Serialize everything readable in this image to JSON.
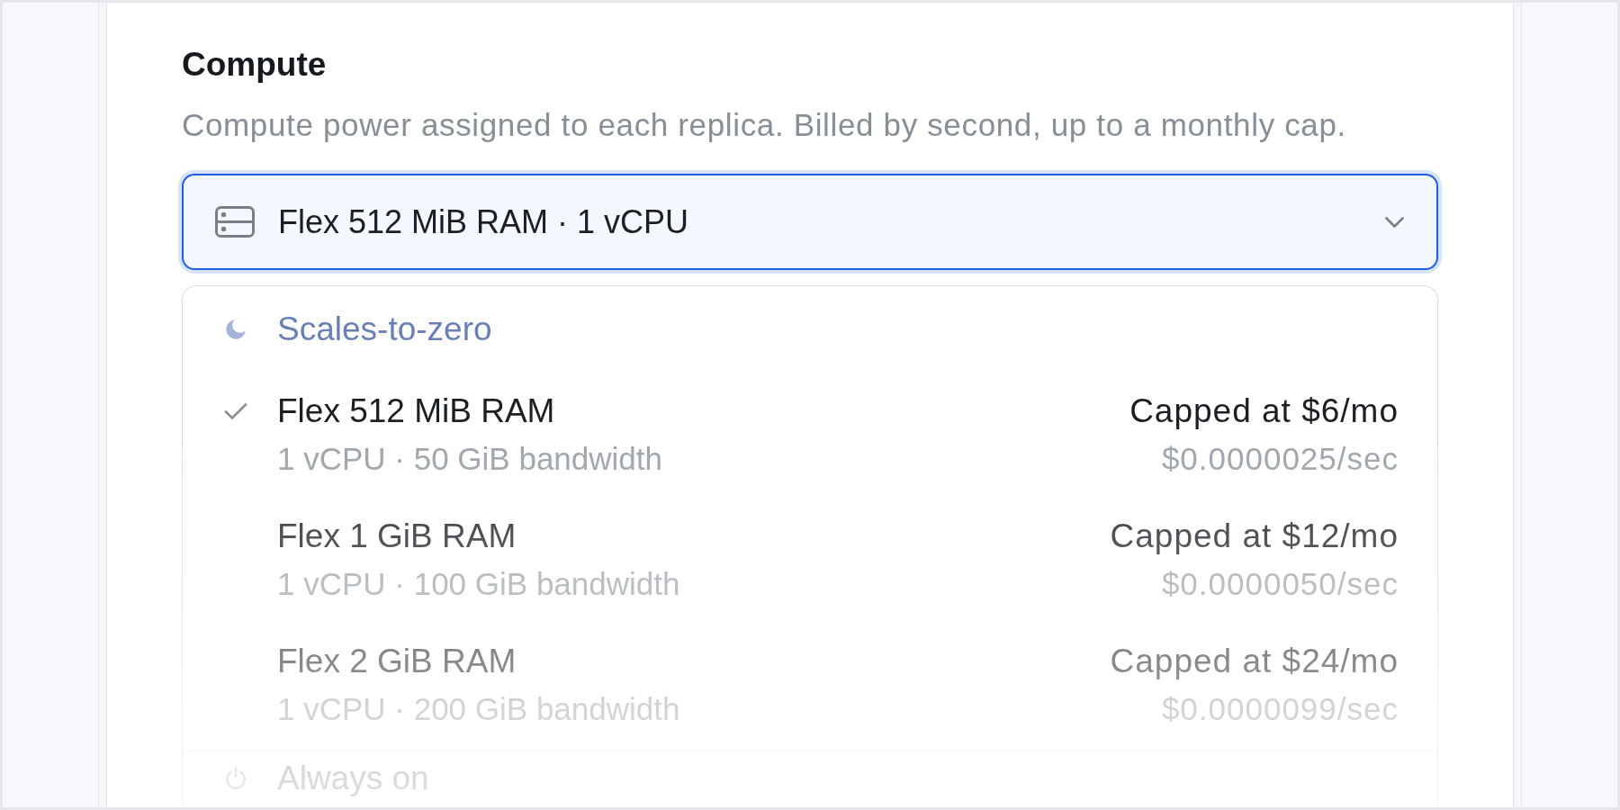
{
  "section": {
    "title": "Compute",
    "description": "Compute power assigned to each replica. Billed by second, up to a monthly cap."
  },
  "select": {
    "value": "Flex 512 MiB RAM · 1 vCPU",
    "focused": true,
    "expanded": true
  },
  "groups": [
    {
      "kind": "serverless",
      "label": "Scales-to-zero",
      "selected": true,
      "options": [
        {
          "name": "Flex 512 MiB RAM",
          "specs": "1 vCPU · 50 GiB bandwidth",
          "cap": "Capped at $6/mo",
          "rate": "$0.0000025/sec",
          "selected": true
        },
        {
          "name": "Flex 1 GiB RAM",
          "specs": "1 vCPU · 100 GiB bandwidth",
          "cap": "Capped at $12/mo",
          "rate": "$0.0000050/sec",
          "selected": false
        },
        {
          "name": "Flex 2 GiB RAM",
          "specs": "1 vCPU · 200 GiB bandwidth",
          "cap": "Capped at $24/mo",
          "rate": "$0.0000099/sec",
          "selected": false
        }
      ]
    },
    {
      "kind": "dedicated",
      "label": "Always on",
      "selected": false
    }
  ]
}
